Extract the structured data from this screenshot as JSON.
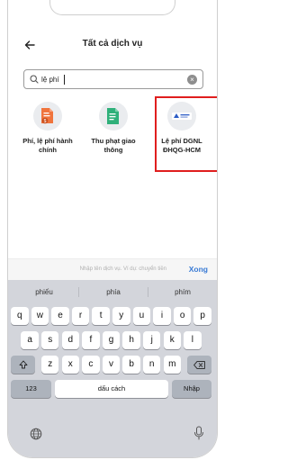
{
  "header": {
    "title": "Tất cả dịch vụ"
  },
  "search": {
    "value": "lệ phí"
  },
  "services": [
    {
      "label_line1": "Phí, lệ phí hành",
      "label_line2": "chính",
      "icon": "document-fee-icon",
      "color": "#f0743d"
    },
    {
      "label_line1": "Thu phạt giao",
      "label_line2": "thông",
      "icon": "traffic-fine-document-icon",
      "color": "#2fb07a"
    },
    {
      "label_line1": "Lệ phí DGNL",
      "label_line2": "ĐHQG-HCM",
      "icon": "university-logo-icon",
      "color": "#2c5cc5"
    }
  ],
  "highlight_color": "#e01e1e",
  "accessory": {
    "hint": "Nhập tên dịch vụ. Ví dụ: chuyển tiền",
    "done": "Xong"
  },
  "keyboard": {
    "suggestions": [
      "phiếu",
      "phía",
      "phím"
    ],
    "row1": [
      "q",
      "w",
      "e",
      "r",
      "t",
      "y",
      "u",
      "i",
      "o",
      "p"
    ],
    "row2": [
      "a",
      "s",
      "d",
      "f",
      "g",
      "h",
      "j",
      "k",
      "l"
    ],
    "row3": [
      "z",
      "x",
      "c",
      "v",
      "b",
      "n",
      "m"
    ],
    "numbers": "123",
    "space": "dấu cách",
    "return": "Nhập"
  }
}
